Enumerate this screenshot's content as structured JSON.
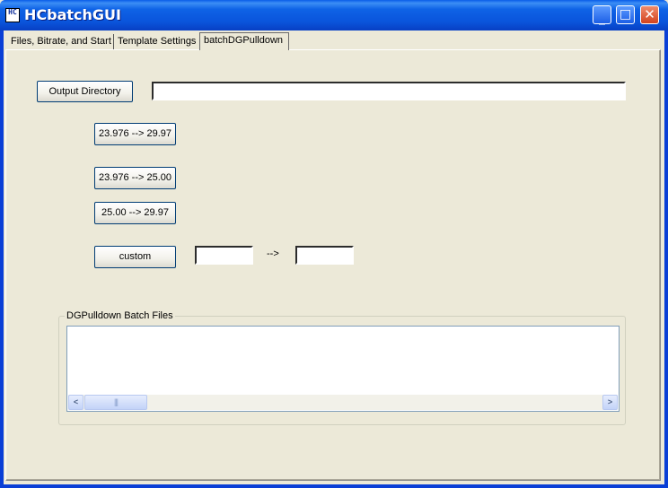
{
  "window": {
    "title": "HCbatchGUI",
    "icon_text": "HC",
    "minimize_glyph": "_",
    "maximize_glyph": "□",
    "close_glyph": "✕"
  },
  "tabs": [
    {
      "label": "Files, Bitrate, and Start",
      "active": false
    },
    {
      "label": "Template Settings",
      "active": false
    },
    {
      "label": "batchDGPulldown",
      "active": true
    }
  ],
  "output_directory": {
    "button_label": "Output Directory",
    "value": ""
  },
  "conversions": {
    "btn_23976_2997": "23.976 --> 29.97",
    "btn_23976_2500": "23.976 --> 25.00",
    "btn_2500_2997": "25.00 --> 29.97",
    "custom_label": "custom",
    "custom_from_value": "",
    "custom_arrow": "-->",
    "custom_to_value": ""
  },
  "batch_files": {
    "group_label": "DGPulldown Batch Files",
    "items": [],
    "scroll_left": "<",
    "scroll_right": ">",
    "scroll_grip": "|||"
  },
  "colors": {
    "titlebar": "#0a55dc",
    "face": "#ece9d8",
    "close_button": "#d2431f"
  }
}
